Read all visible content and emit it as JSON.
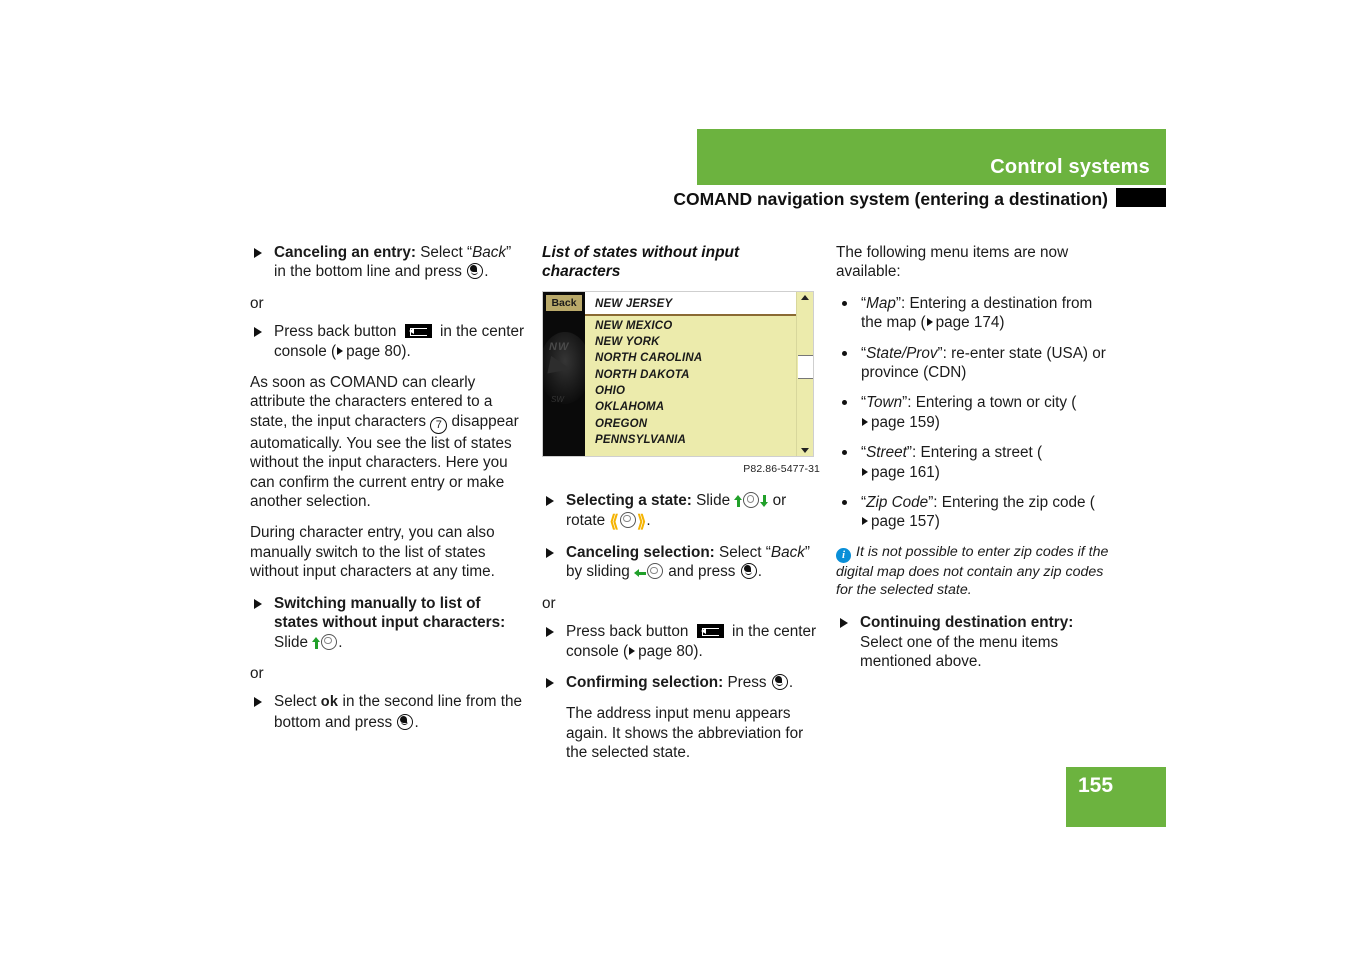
{
  "header": {
    "section_title": "Control systems",
    "subtitle": "COMAND navigation system (entering a destination)"
  },
  "page_number": "155",
  "left_column": {
    "item1_label": "Canceling an entry:",
    "item1_text_a": " Select “",
    "item1_italic": "Back",
    "item1_text_b": "” in the bottom line and press",
    "or1": "or",
    "item2_text_a": "Press back button",
    "item2_text_b": "in the center console (",
    "item2_page": "page 80).",
    "para1_a": "As soon as COMAND can clearly attribute the characters entered to a state, the input characters ",
    "para1_circled": "7",
    "para1_b": " disappear automatically. You see the list of states without the input characters. Here you can confirm the current entry or make another selection.",
    "para2": "During character entry, you can also manually switch to the list of states without input characters at any time.",
    "item3_label": "Switching manually to list of states without input characters:",
    "item3_text": " Slide",
    "or2": "or",
    "item4_text_a": "Select",
    "item4_kw": "ok",
    "item4_text_b": "in the second line from the bottom and press"
  },
  "middle_column": {
    "figure_title": "List of states without input characters",
    "screen": {
      "back_label": "Back",
      "compass_label": "NW",
      "compass_sub": "SW",
      "selected_item": "NEW JERSEY",
      "list_items": [
        "NEW MEXICO",
        "NEW YORK",
        "NORTH CAROLINA",
        "NORTH DAKOTA",
        "OHIO",
        "OKLAHOMA",
        "OREGON",
        "PENNSYLVANIA"
      ]
    },
    "figure_caption": "P82.86-5477-31",
    "item1_label": "Selecting a state:",
    "item1_text_a": " Slide",
    "item1_text_b": "or rotate",
    "item2_label": "Canceling selection:",
    "item2_text_a": " Select “",
    "item2_italic": "Back",
    "item2_text_b": "” by sliding",
    "item2_text_c": "and press",
    "or": "or",
    "item3_text_a": "Press back button",
    "item3_text_b": "in the center console (",
    "item3_page": "page 80).",
    "item4_label": "Confirming selection:",
    "item4_text": " Press",
    "para": "The address input menu appears again. It shows the abbreviation for the selected state."
  },
  "right_column": {
    "intro": "The following menu items are now available:",
    "bullets": [
      {
        "quoted": "Map",
        "rest": "”: Entering a destination from the map (",
        "page": "page 174)"
      },
      {
        "quoted": "State/Prov",
        "rest": "”: re-enter state (USA) or province (CDN)",
        "page": ""
      },
      {
        "quoted": "Town",
        "rest": "”: Entering a town or city (",
        "page": "page 159)"
      },
      {
        "quoted": "Street",
        "rest": "”: Entering a street (",
        "page": "page 161)"
      },
      {
        "quoted": "Zip Code",
        "rest": "”: Entering the zip code (",
        "page": "page 157)"
      }
    ],
    "note": "It is not possible to enter zip codes if the digital map does not contain any zip codes for the selected state.",
    "item_label": "Continuing destination entry:",
    "item_text": "Select one of the menu items mentioned above."
  },
  "colors": {
    "brand_green": "#6cb33f",
    "screen_yellow": "#ecebac",
    "info_blue": "#0a8fd8",
    "arrow_green": "#21a02a",
    "bracket_yellow": "#f5b301"
  }
}
